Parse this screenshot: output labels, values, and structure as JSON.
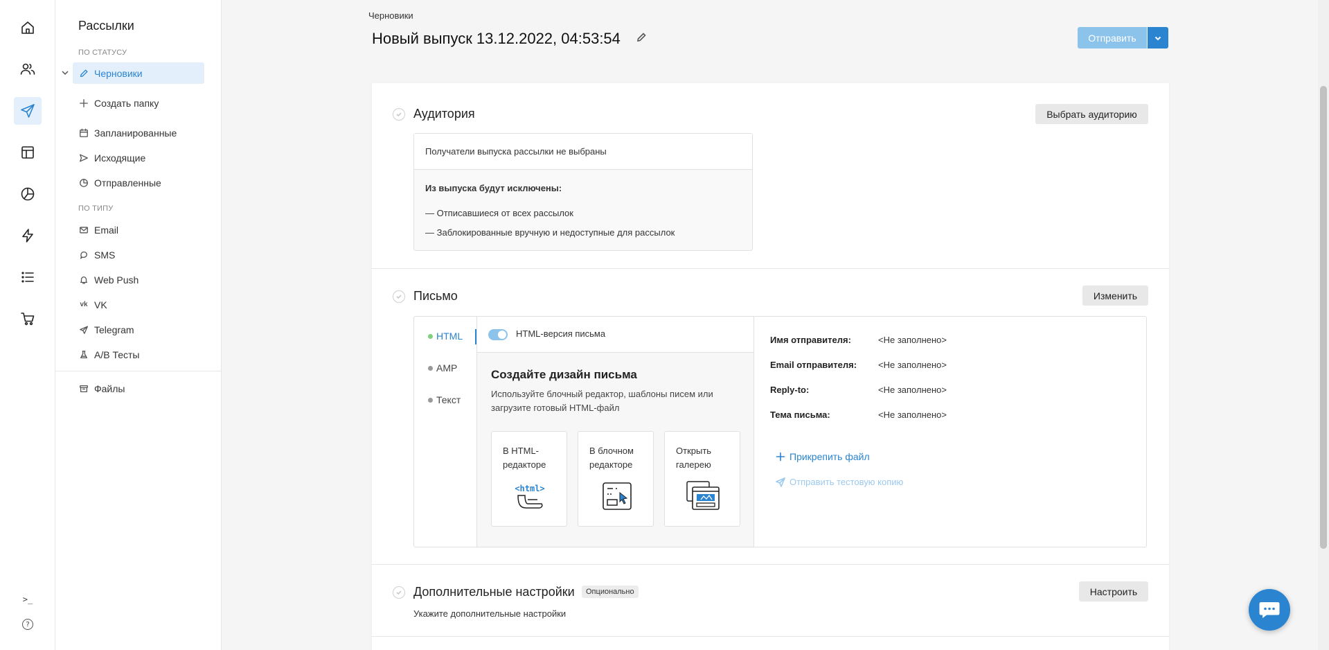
{
  "sidebar": {
    "title": "Рассылки",
    "status_section": "ПО СТАТУСУ",
    "type_section": "ПО ТИПУ",
    "drafts": "Черновики",
    "create_folder": "Создать папку",
    "scheduled": "Запланированные",
    "outgoing": "Исходящие",
    "sent": "Отправленные",
    "email": "Email",
    "sms": "SMS",
    "webpush": "Web Push",
    "vk": "VK",
    "telegram": "Telegram",
    "ab": "A/B Тесты",
    "files": "Файлы"
  },
  "rail": {
    "console": ">_",
    "help": "?"
  },
  "header": {
    "breadcrumb": "Черновики",
    "title": "Новый выпуск 13.12.2022, 04:53:54",
    "send": "Отправить"
  },
  "audience": {
    "title": "Аудитория",
    "button": "Выбрать аудиторию",
    "no_recipients": "Получатели выпуска рассылки не выбраны",
    "excluded_title": "Из выпуска будут исключены:",
    "excluded_1": "— Отписавшиеся от всех рассылок",
    "excluded_2": "— Заблокированные вручную и недоступные для рассылок"
  },
  "letter": {
    "title": "Письмо",
    "button": "Изменить",
    "tabs": [
      "HTML",
      "AMP",
      "Текст"
    ],
    "toggle_label": "HTML-версия письма",
    "design_title": "Создайте дизайн письма",
    "design_desc": "Используйте блочный редактор, шаблоны писем или загрузите готовый HTML-файл",
    "options": [
      "В HTML-редакторе",
      "В блочном редакторе",
      "Открыть галерею"
    ],
    "html_icon_text": "<html>",
    "sender_name_label": "Имя отправителя:",
    "sender_email_label": "Email отправителя:",
    "reply_to_label": "Reply-to:",
    "subject_label": "Тема письма:",
    "empty_value": "<Не заполнено>",
    "attach": "Прикрепить файл",
    "test_copy": "Отправить тестовую копию"
  },
  "extra": {
    "title": "Дополнительные настройки",
    "badge": "Опционально",
    "button": "Настроить",
    "desc": "Укажите дополнительные настройки"
  },
  "colors": {
    "accent": "#2a84d0",
    "accent_light": "#8cc3ea",
    "active_bg": "#e3f0fb",
    "html_dot": "#7ed07e"
  }
}
